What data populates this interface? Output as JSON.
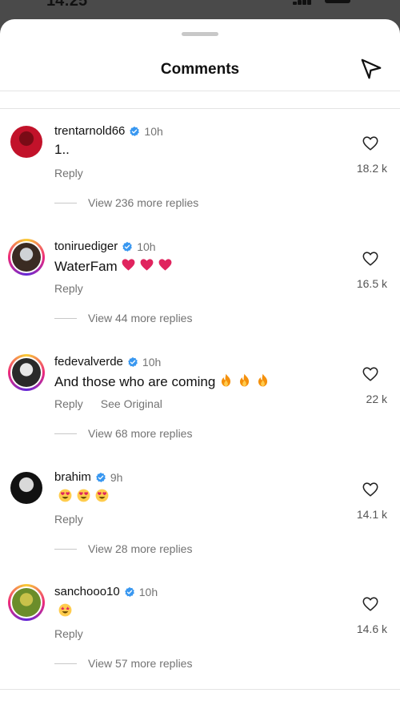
{
  "status": {
    "time": "14:25"
  },
  "sheet": {
    "title": "Comments"
  },
  "comments": [
    {
      "username": "trentarnold66",
      "time": "10h",
      "text": "1..",
      "emojis": [],
      "actions": [
        "Reply"
      ],
      "likes": "18.2 k",
      "view_more": "View 236 more replies",
      "ring": false,
      "avatar_colors": [
        "#c2122a",
        "#7a0b16"
      ]
    },
    {
      "username": "toniruediger",
      "time": "10h",
      "text": "WaterFam",
      "emojis": [
        "red-heart",
        "red-heart",
        "red-heart"
      ],
      "actions": [
        "Reply"
      ],
      "likes": "16.5 k",
      "view_more": "View 44 more replies",
      "ring": true,
      "avatar_colors": [
        "#3a2b22",
        "#cfd2d6"
      ]
    },
    {
      "username": "fedevalverde",
      "time": "10h",
      "text": "And those who are coming",
      "emojis": [
        "fire",
        "fire",
        "fire"
      ],
      "actions": [
        "Reply",
        "See Original"
      ],
      "likes": "22 k",
      "view_more": "View 68 more replies",
      "ring": true,
      "avatar_colors": [
        "#2a2a2a",
        "#e8e8e8"
      ]
    },
    {
      "username": "brahim",
      "time": "9h",
      "text": "",
      "emojis": [
        "heart-eyes",
        "heart-eyes",
        "heart-eyes"
      ],
      "actions": [
        "Reply"
      ],
      "likes": "14.1 k",
      "view_more": "View 28 more replies",
      "ring": false,
      "avatar_colors": [
        "#111111",
        "#d9d9d9"
      ]
    },
    {
      "username": "sanchooo10",
      "time": "10h",
      "text": "",
      "emojis": [
        "star-struck"
      ],
      "actions": [
        "Reply"
      ],
      "likes": "14.6 k",
      "view_more": "View 57 more replies",
      "ring": true,
      "avatar_colors": [
        "#6b8d2a",
        "#c9c24a"
      ]
    }
  ],
  "colors": {
    "verified": "#3897f0",
    "muted": "#737373",
    "heart_emoji": "#e0245e",
    "fire": "#f4900c"
  }
}
